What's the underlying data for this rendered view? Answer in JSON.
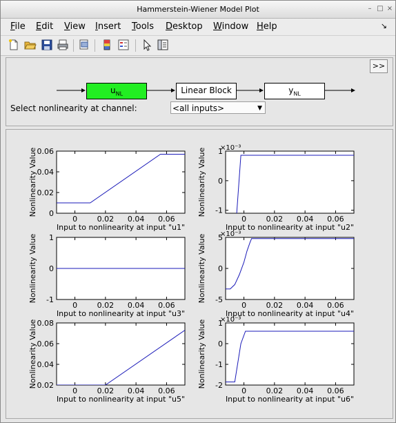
{
  "window": {
    "title": "Hammerstein-Wiener Model Plot"
  },
  "menu": [
    {
      "label": "File",
      "underline": "F",
      "rest": "ile"
    },
    {
      "label": "Edit",
      "underline": "E",
      "rest": "dit"
    },
    {
      "label": "View",
      "underline": "V",
      "rest": "iew"
    },
    {
      "label": "Insert",
      "underline": "I",
      "rest": "nsert"
    },
    {
      "label": "Tools",
      "underline": "T",
      "rest": "ools"
    },
    {
      "label": "Desktop",
      "underline": "D",
      "rest": "esktop"
    },
    {
      "label": "Window",
      "underline": "W",
      "rest": "indow"
    },
    {
      "label": "Help",
      "underline": "H",
      "rest": "elp"
    }
  ],
  "toolbar": {
    "icons": [
      "new-file-icon",
      "open-folder-icon",
      "save-icon",
      "print-icon",
      "print-preview-icon",
      "colorbar-icon",
      "legend-icon",
      "pointer-icon",
      "property-editor-icon"
    ]
  },
  "diagram": {
    "expand_label": ">>",
    "unl": {
      "main": "u",
      "sub": "NL"
    },
    "linear_label": "Linear Block",
    "ynl": {
      "main": "y",
      "sub": "NL"
    },
    "unl_color": "#22ee22",
    "select_label": "Select nonlinearity at channel:",
    "select_value": "<all inputs>"
  },
  "chart_data": [
    {
      "type": "line",
      "xlabel": "Input to nonlinearity at input \"u1\"",
      "ylabel": "Nonlinearity Value",
      "x": [
        -0.012,
        0.01,
        0.056,
        0.072
      ],
      "y": [
        0.01,
        0.01,
        0.057,
        0.057
      ],
      "xlim": [
        -0.012,
        0.072
      ],
      "ylim": [
        0,
        0.06
      ],
      "xticks": [
        0,
        0.02,
        0.04,
        0.06
      ],
      "xtick_labels": [
        "0",
        "0.02",
        "0.04",
        "0.06"
      ],
      "yticks": [
        0,
        0.02,
        0.04,
        0.06
      ],
      "ytick_labels": [
        "0",
        "0.02",
        "0.04",
        "0.06"
      ],
      "exponent": "",
      "color": "#1a1ab8"
    },
    {
      "type": "line",
      "xlabel": "Input to nonlinearity at input \"u2\"",
      "ylabel": "Nonlinearity Value",
      "x": [
        -0.012,
        -0.005,
        -0.002,
        0.072
      ],
      "y": [
        -1.3,
        -1.3,
        0.86,
        0.86
      ],
      "xlim": [
        -0.012,
        0.072
      ],
      "ylim": [
        -1.1,
        1
      ],
      "xticks": [
        0,
        0.02,
        0.04,
        0.06
      ],
      "xtick_labels": [
        "0",
        "0.02",
        "0.04",
        "0.06"
      ],
      "yticks": [
        -1,
        0,
        1
      ],
      "ytick_labels": [
        "-1",
        "0",
        "1"
      ],
      "exponent": "×10⁻³",
      "color": "#1a1ab8"
    },
    {
      "type": "line",
      "xlabel": "Input to nonlinearity at input \"u3\"",
      "ylabel": "Nonlinearity Value",
      "x": [
        -0.012,
        0.072
      ],
      "y": [
        0,
        0
      ],
      "xlim": [
        -0.012,
        0.072
      ],
      "ylim": [
        -1,
        1
      ],
      "xticks": [
        0,
        0.02,
        0.04,
        0.06
      ],
      "xtick_labels": [
        "0",
        "0.02",
        "0.04",
        "0.06"
      ],
      "yticks": [
        -1,
        0,
        1
      ],
      "ytick_labels": [
        "-1",
        "0",
        "1"
      ],
      "exponent": "",
      "color": "#1a1ab8"
    },
    {
      "type": "line",
      "xlabel": "Input to nonlinearity at input \"u4\"",
      "ylabel": "Nonlinearity Value",
      "x": [
        -0.012,
        -0.009,
        -0.006,
        -0.003,
        0.0,
        0.002,
        0.004,
        0.005,
        0.072
      ],
      "y": [
        -3.3,
        -3.3,
        -2.6,
        -1.0,
        1.0,
        2.8,
        4.2,
        4.8,
        4.8
      ],
      "xlim": [
        -0.012,
        0.072
      ],
      "ylim": [
        -5,
        5
      ],
      "xticks": [
        0,
        0.02,
        0.04,
        0.06
      ],
      "xtick_labels": [
        "0",
        "0.02",
        "0.04",
        "0.06"
      ],
      "yticks": [
        -5,
        0,
        5
      ],
      "ytick_labels": [
        "-5",
        "0",
        "5"
      ],
      "exponent": "×10⁻³",
      "color": "#1a1ab8"
    },
    {
      "type": "line",
      "xlabel": "Input to nonlinearity at input \"u5\"",
      "ylabel": "Nonlinearity Value",
      "x": [
        -0.012,
        0.02,
        0.072
      ],
      "y": [
        0.02,
        0.02,
        0.073
      ],
      "xlim": [
        -0.012,
        0.072
      ],
      "ylim": [
        0.02,
        0.08
      ],
      "xticks": [
        0,
        0.02,
        0.04,
        0.06
      ],
      "xtick_labels": [
        "0",
        "0.02",
        "0.04",
        "0.06"
      ],
      "yticks": [
        0.02,
        0.04,
        0.06,
        0.08
      ],
      "ytick_labels": [
        "0.02",
        "0.04",
        "0.06",
        "0.08"
      ],
      "exponent": "",
      "color": "#1a1ab8"
    },
    {
      "type": "line",
      "xlabel": "Input to nonlinearity at input \"u6\"",
      "ylabel": "Nonlinearity Value",
      "x": [
        -0.012,
        -0.006,
        -0.002,
        0.001,
        0.072
      ],
      "y": [
        -1.85,
        -1.85,
        0.0,
        0.6,
        0.6
      ],
      "xlim": [
        -0.012,
        0.072
      ],
      "ylim": [
        -2,
        1
      ],
      "xticks": [
        0,
        0.02,
        0.04,
        0.06
      ],
      "xtick_labels": [
        "0",
        "0.02",
        "0.04",
        "0.06"
      ],
      "yticks": [
        -2,
        -1,
        0,
        1
      ],
      "ytick_labels": [
        "-2",
        "-1",
        "0",
        "1"
      ],
      "exponent": "×10⁻³",
      "color": "#1a1ab8"
    }
  ]
}
